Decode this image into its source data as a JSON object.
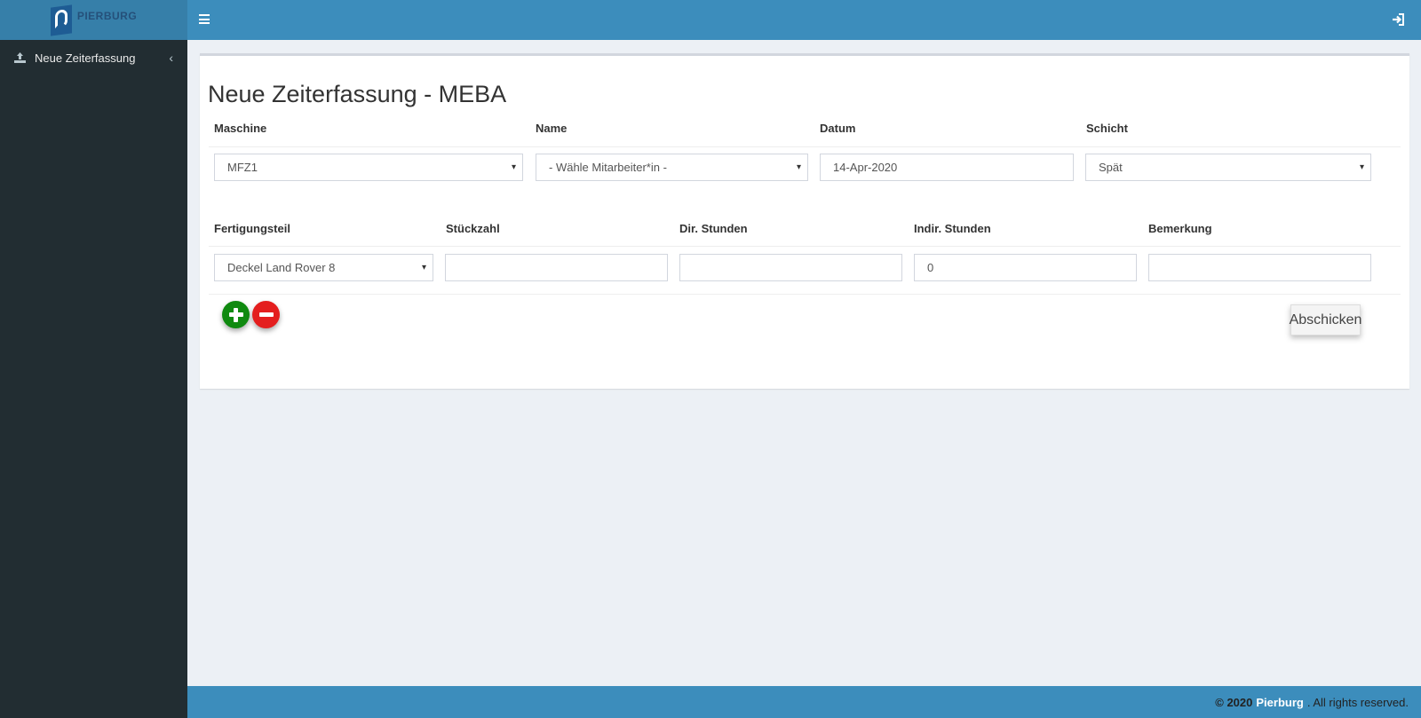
{
  "brand": {
    "logo_text": "PIERBURG"
  },
  "sidebar": {
    "items": [
      {
        "label": "Neue Zeiterfassung",
        "icon": "upload-icon"
      }
    ]
  },
  "header": {
    "menu_icon": "hamburger-icon",
    "logout_icon": "sign-in-icon"
  },
  "page": {
    "title": "Neue Zeiterfassung - MEBA",
    "row1": {
      "maschine_label": "Maschine",
      "name_label": "Name",
      "datum_label": "Datum",
      "schicht_label": "Schicht",
      "maschine_value": "MFZ1",
      "name_value": "- Wähle Mitarbeiter*in -",
      "datum_value": "14-Apr-2020",
      "schicht_value": "Spät"
    },
    "row2": {
      "fertigungsteil_label": "Fertigungsteil",
      "stueckzahl_label": "Stückzahl",
      "dir_stunden_label": "Dir. Stunden",
      "indir_stunden_label": "Indir. Stunden",
      "bemerkung_label": "Bemerkung",
      "fertigungsteil_value": "Deckel Land Rover 8",
      "stueckzahl_value": "",
      "dir_stunden_value": "",
      "indir_stunden_value": "0",
      "bemerkung_value": ""
    },
    "submit_label": "Abschicken"
  },
  "footer": {
    "copyright": "© 2020",
    "brand": "Pierburg",
    "rights": ". All rights reserved."
  },
  "colors": {
    "header": "#3c8dbc",
    "sidebar": "#222d32",
    "add": "#108a10",
    "remove": "#e41e1e"
  }
}
